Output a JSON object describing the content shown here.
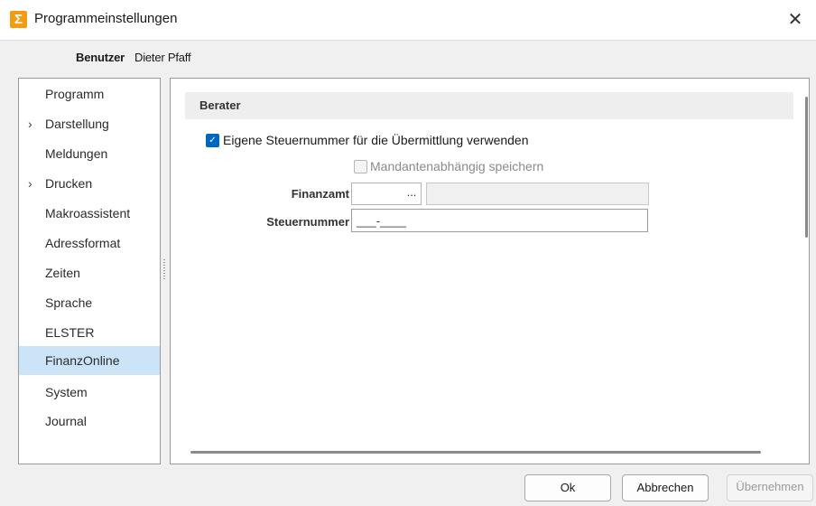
{
  "window": {
    "title": "Programmeinstellungen"
  },
  "user": {
    "label": "Benutzer",
    "name": "Dieter Pfaff"
  },
  "sidebar": {
    "items": [
      {
        "label": "Programm",
        "expandable": false
      },
      {
        "label": "Darstellung",
        "expandable": true
      },
      {
        "label": "Meldungen",
        "expandable": false
      },
      {
        "label": "Drucken",
        "expandable": true
      },
      {
        "label": "Makroassistent",
        "expandable": false
      },
      {
        "label": "Adressformat",
        "expandable": false
      },
      {
        "label": "Zeiten",
        "expandable": false
      },
      {
        "label": "Sprache",
        "expandable": false
      },
      {
        "label": "ELSTER",
        "expandable": false
      },
      {
        "label": "FinanzOnline",
        "expandable": false,
        "selected": true
      },
      {
        "label": "System",
        "expandable": false
      },
      {
        "label": "Journal",
        "expandable": false
      }
    ]
  },
  "section": {
    "title": "Berater"
  },
  "options": {
    "own_tax_number": {
      "label": "Eigene Steuernummer für die Übermittlung verwenden",
      "checked": true
    },
    "per_client": {
      "label": "Mandantenabhängig speichern",
      "checked": false,
      "enabled": false
    }
  },
  "fields": {
    "tax_office": {
      "label": "Finanzamt",
      "value": "",
      "browse": "..."
    },
    "tax_number": {
      "label": "Steuernummer",
      "value": "___-____"
    }
  },
  "buttons": {
    "ok": "Ok",
    "cancel": "Abbrechen",
    "apply": "Übernehmen"
  },
  "colors": {
    "accent": "#0067c0",
    "selected_bg": "#cce4f7",
    "app_icon": "#f39c12"
  }
}
